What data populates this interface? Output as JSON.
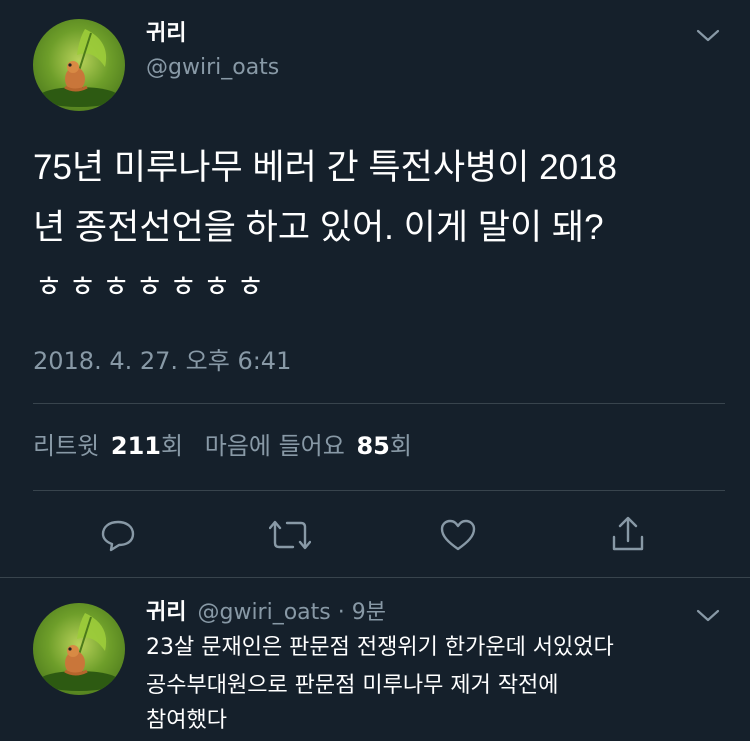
{
  "tweet": {
    "display_name": "귀리",
    "handle": "@gwiri_oats",
    "text_line1": "75년 미루나무 베러 간 특전사병이 2018",
    "text_line2": "년 종전선언을 하고 있어. 이게 말이 돼?",
    "text_line3": "ㅎㅎㅎㅎㅎㅎㅎ",
    "timestamp": "2018. 4. 27. 오후 6:41",
    "stats": {
      "retweets_label": "리트윗",
      "retweets_count": "211",
      "retweets_unit": "회",
      "likes_label": "마음에 들어요",
      "likes_count": "85",
      "likes_unit": "회"
    }
  },
  "reply": {
    "display_name": "귀리",
    "handle": "@gwiri_oats",
    "separator": "·",
    "age": "9분",
    "line1": "23살 문재인은 판문점 전쟁위기 한가운데 서있었다",
    "line2": "공수부대원으로 판문점 미루나무 제거 작전에",
    "line3": "참여했다"
  },
  "icons": {
    "menu": "chevron-down-icon",
    "reply": "reply-icon",
    "retweet": "retweet-icon",
    "like": "heart-icon",
    "share": "share-icon"
  },
  "colors": {
    "background": "#15202b",
    "text": "#ffffff",
    "muted": "#8899a6",
    "divider": "#38444d"
  }
}
